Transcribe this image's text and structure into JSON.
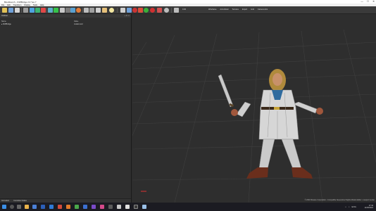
{
  "window": {
    "title": "Blockbench - FIWBridge 2.0 Yes 7",
    "controls": [
      "—",
      "☐",
      "✕"
    ]
  },
  "menu": [
    "File",
    "Edit",
    "Transform",
    "Display",
    "Tools",
    "Help"
  ],
  "toolbar": {
    "numeric_value": "0.00"
  },
  "view_menu": [
    "Wireframe",
    "Adv-Model",
    "Textures",
    "Export",
    "Grid",
    "Camera Axis"
  ],
  "outliner": {
    "title": "Outliner",
    "controls": "+ ⊡ ✕",
    "columns": [
      "Name",
      "Value"
    ],
    "rows": [
      {
        "name": "▸ FIWBridge",
        "value": "model.mod"
      }
    ]
  },
  "left_bottom_tabs": [
    "Animation",
    "Controller Nodes"
  ],
  "viewport": {
    "status": "© 2001 Bioware Corporation • Compatible Neverwinter Nights Models Editor • viewport render"
  },
  "taskbar": {
    "time": "17:42",
    "date": "11/25/2021",
    "lang": "ENG"
  }
}
